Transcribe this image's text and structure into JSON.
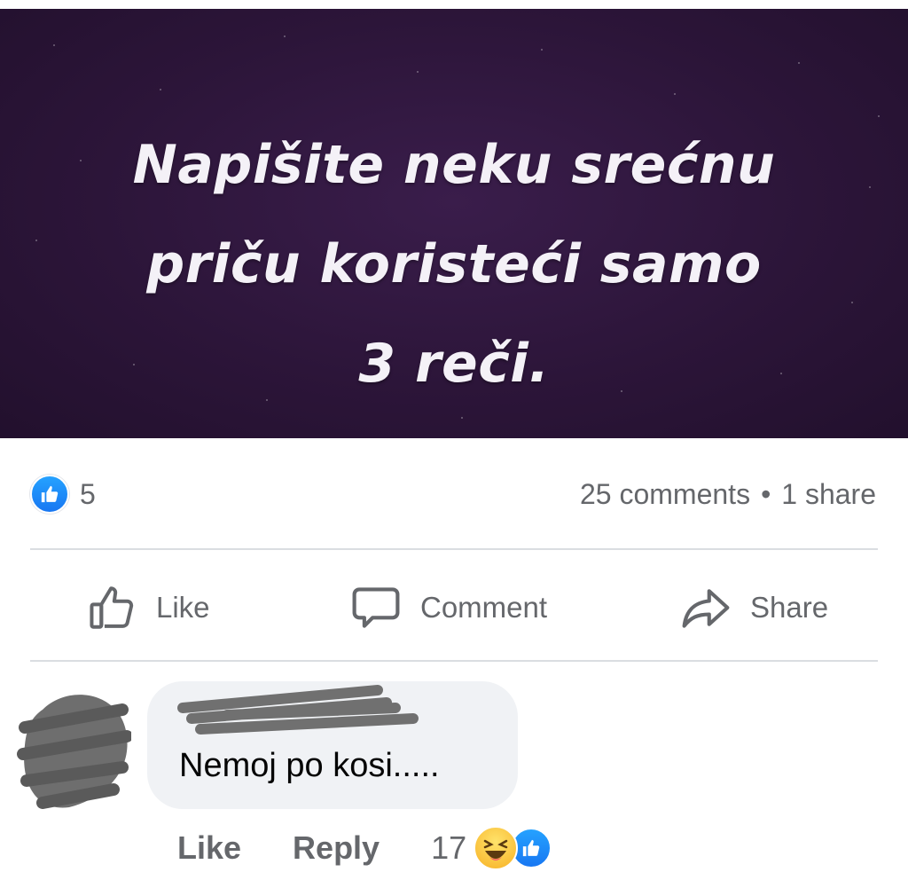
{
  "post": {
    "image_text": [
      "Napišite neku srećnu",
      "priču koristeći samo",
      "3 reči."
    ],
    "reactions": {
      "icon": "like-icon",
      "count": "5",
      "accent": "#1877f2"
    },
    "stats": {
      "comments": "25 comments",
      "separator": "•",
      "shares": "1 share"
    }
  },
  "actions": {
    "like": {
      "label": "Like",
      "icon": "thumbs-up-icon"
    },
    "comment": {
      "label": "Comment",
      "icon": "speech-bubble-icon"
    },
    "share": {
      "label": "Share",
      "icon": "share-arrow-icon"
    }
  },
  "comment": {
    "text": "Nemoj po kosi.....",
    "like_label": "Like",
    "reply_label": "Reply",
    "reaction_count": "17",
    "reaction_icons": [
      "haha-icon",
      "like-icon"
    ]
  }
}
